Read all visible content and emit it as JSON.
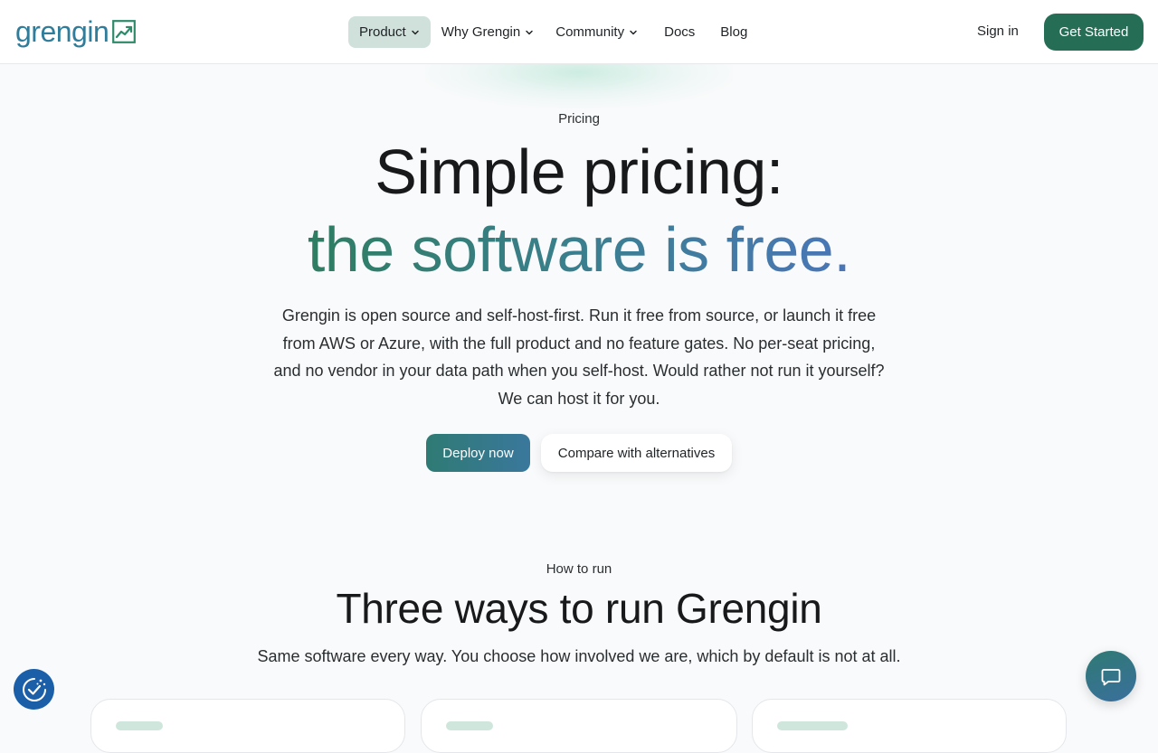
{
  "brand": {
    "name": "grengin",
    "color": "#2f7d9a",
    "accent": "#256e55"
  },
  "nav": {
    "items": [
      {
        "label": "Product",
        "dropdown": true,
        "active": true
      },
      {
        "label": "Why Grengin",
        "dropdown": true
      },
      {
        "label": "Community",
        "dropdown": true
      },
      {
        "label": "Docs",
        "dropdown": false
      },
      {
        "label": "Blog",
        "dropdown": false
      }
    ],
    "sign_in": "Sign in",
    "get_started": "Get Started"
  },
  "hero": {
    "label": "Pricing",
    "title_line1": "Simple pricing:",
    "title_line2": "the software is free.",
    "description": "Grengin is open source and self-host-first. Run it free from source, or launch it free from AWS or Azure, with the full product and no feature gates. No per-seat pricing, and no vendor in your data path when you self-host. Would rather not run it yourself? We can host it for you.",
    "primary_cta": "Deploy now",
    "secondary_cta": "Compare with alternatives"
  },
  "how_to_run": {
    "label": "How to run",
    "title": "Three ways to run Grengin",
    "subtitle": "Same software every way. You choose how involved we are, which by default is not at all."
  },
  "icons": {
    "cookie": "cookie-consent-icon",
    "chat": "chat-bubble-icon",
    "chevron": "chevron-down-icon",
    "logo": "trend-chart-icon"
  }
}
